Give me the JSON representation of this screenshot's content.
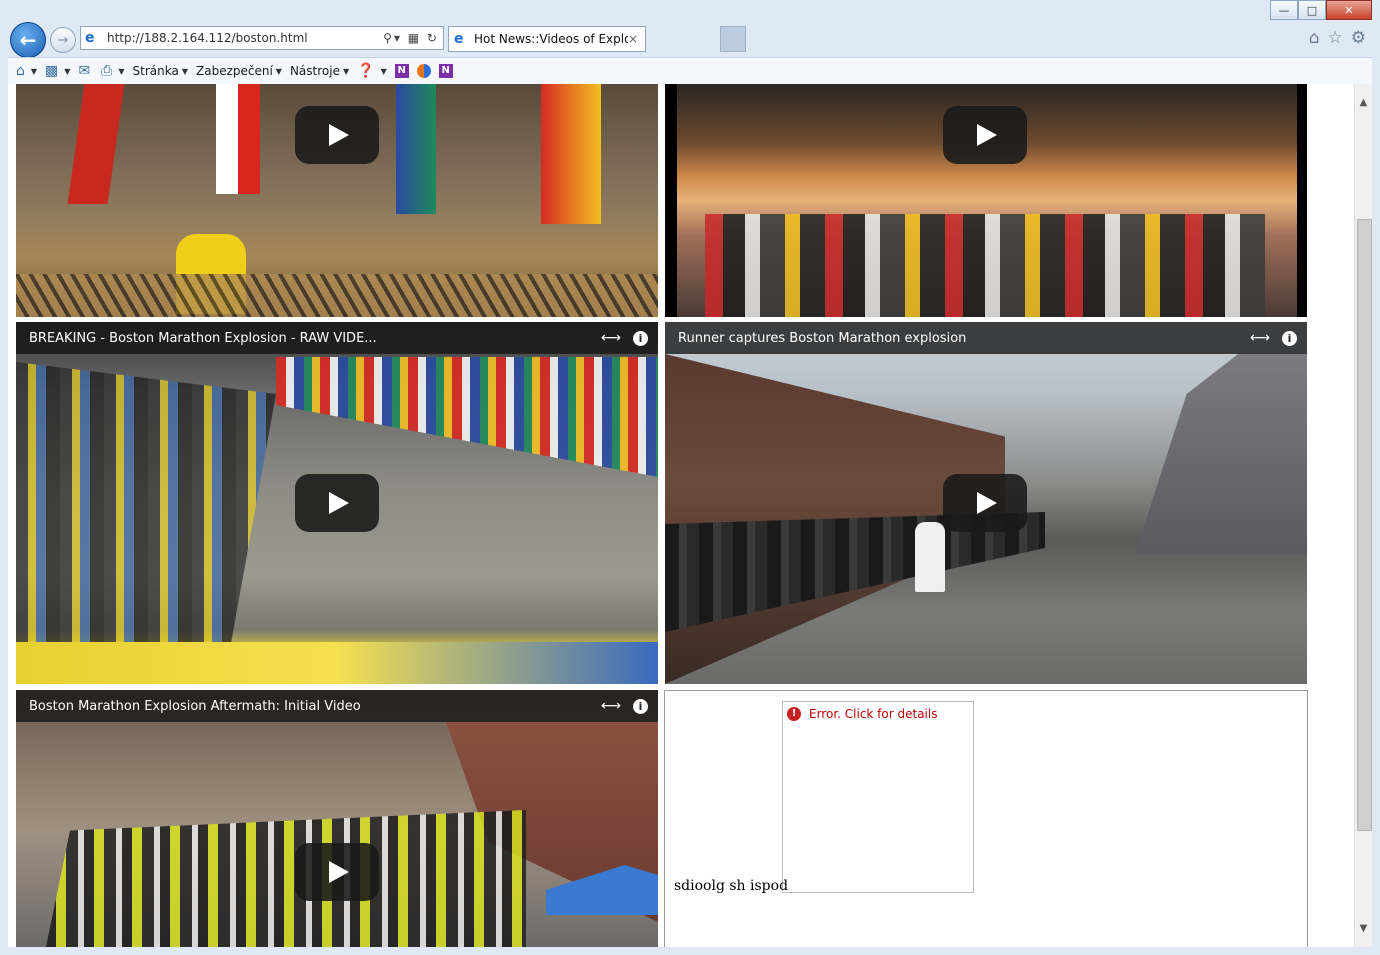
{
  "browser": {
    "url": "http://188.2.164.112/boston.html",
    "tab_title": "Hot News::Videos of Explosi...",
    "tab_close": "×",
    "window_buttons": {
      "minimize": "—",
      "maximize": "□",
      "close": "✕"
    },
    "toolbar_icons": [
      "home-icon",
      "favorites-star-icon",
      "gear-icon"
    ]
  },
  "command_bar": {
    "items": [
      {
        "label": "Stránka"
      },
      {
        "label": "Zabezpečení"
      },
      {
        "label": "Nástroje"
      }
    ]
  },
  "videos": [
    {
      "title": ""
    },
    {
      "title": ""
    },
    {
      "title": "BREAKING - Boston Marathon Explosion - RAW VIDE..."
    },
    {
      "title": "Runner captures Boston Marathon explosion"
    },
    {
      "title": "Boston Marathon Explosion Aftermath: Initial Video"
    }
  ],
  "error_widget": {
    "message": "Error. Click for details",
    "icon": "!"
  },
  "page_text": "sdioolg sh ispod",
  "colors": {
    "error_red": "#c00000",
    "video_bar": "#141414",
    "ie_blue": "#1a6fd1"
  }
}
